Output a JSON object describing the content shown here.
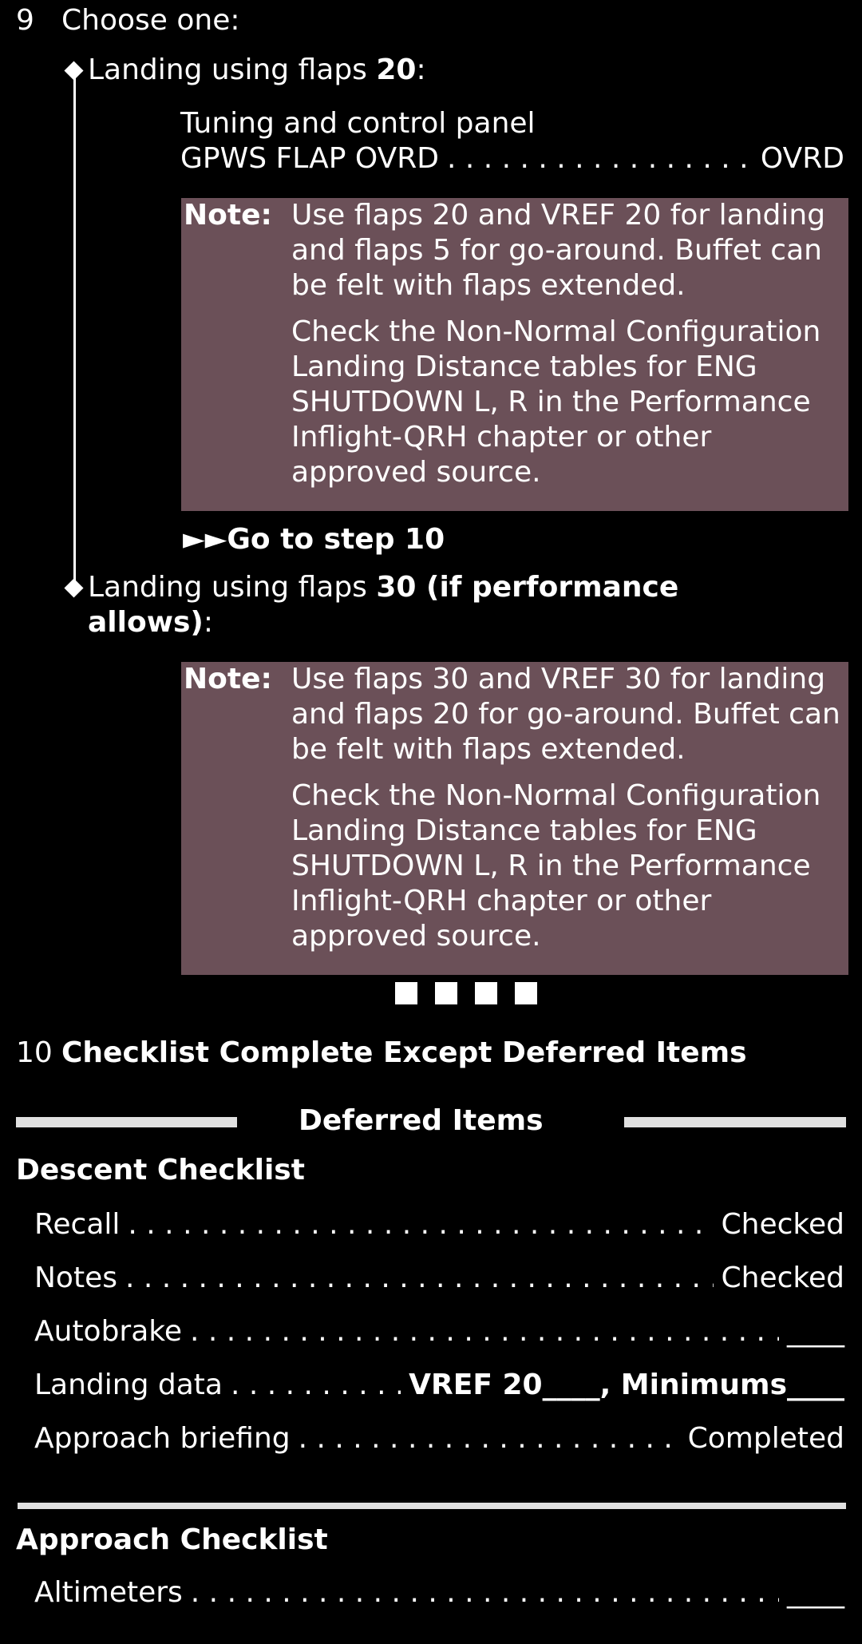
{
  "step9": {
    "number": "9",
    "title": "Choose one:",
    "option1": {
      "label_prefix": "Landing using flaps ",
      "label_bold": "20",
      "label_suffix": ":",
      "panel_line": "Tuning and control panel",
      "item_label": "GPWS FLAP OVRD",
      "item_value": "OVRD",
      "note_label": "Note:",
      "note_p1": "Use flaps 20 and VREF 20 for landing and flaps 5 for go-around. Buffet can be felt with flaps extended.",
      "note_p2": "Check the Non-Normal Configuration Landing Distance tables for ENG SHUTDOWN L, R in the Performance Inflight-QRH chapter or other approved source.",
      "goto_arrows": "►►",
      "goto_text": "Go to step 10"
    },
    "option2": {
      "label_prefix": "Landing using flaps ",
      "label_bold_line1": "30 (if performance",
      "label_bold_line2": "allows)",
      "label_suffix": ":",
      "note_label": "Note:",
      "note_p1": "Use flaps 30 and VREF 30 for landing and flaps 20 for go-around. Buffet can be felt with flaps extended.",
      "note_p2": "Check the Non-Normal Configuration Landing Distance tables for ENG SHUTDOWN L, R in the Performance Inflight-QRH chapter or other approved source."
    }
  },
  "step10": {
    "number": "10",
    "title": "Checklist Complete Except Deferred Items"
  },
  "deferred": {
    "heading": "Deferred Items",
    "descent": {
      "title": "Descent Checklist",
      "items": [
        {
          "label": "Recall",
          "value": "Checked"
        },
        {
          "label": "Notes",
          "value": "Checked"
        },
        {
          "label": "Autobrake",
          "value": "____"
        },
        {
          "label": "Landing data",
          "value": "VREF 20____, Minimums____"
        },
        {
          "label": "Approach briefing",
          "value": "Completed"
        }
      ]
    },
    "approach": {
      "title": "Approach Checklist",
      "items": [
        {
          "label": "Altimeters",
          "value": "____"
        }
      ]
    }
  },
  "colors": {
    "background": "#000000",
    "note_fill": "#6b5058",
    "divider": "#e0e0e0"
  }
}
